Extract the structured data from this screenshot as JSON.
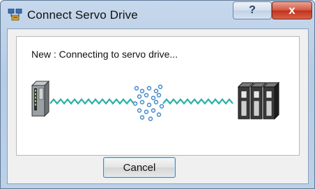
{
  "window": {
    "title": "Connect Servo Drive"
  },
  "titlebar": {
    "help_glyph": "?",
    "close_glyph": "x",
    "app_icon": "network-drive-icon"
  },
  "dialog": {
    "status_text": "New : Connecting to servo drive...",
    "cancel_label": "Cancel"
  },
  "illustration": {
    "left_device": "controller-icon",
    "right_device": "servo-drive-rack-icon",
    "signal": "connection-wave-icon"
  },
  "colors": {
    "wave": "#2fb0a6",
    "sparks": "#3a86c8",
    "close": "#c8402a"
  }
}
